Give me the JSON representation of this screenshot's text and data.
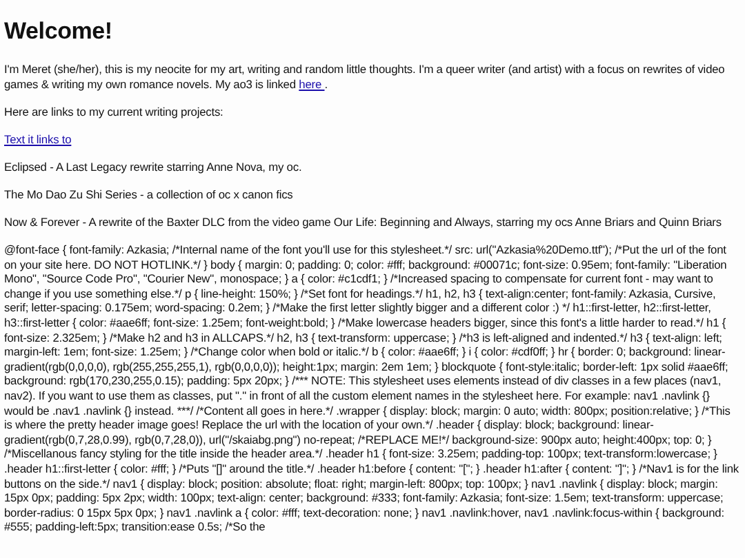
{
  "heading": "Welcome!",
  "intro": {
    "text": "I'm Meret (she/her), this is my neocite for my art, writing and random little thoughts. I'm a queer writer (and artist) with a focus on rewrites of video games & writing my own romance novels. My ao3 is linked ",
    "link": "here ",
    "after": "."
  },
  "projects_intro": "Here are links to my current writing projects:",
  "link": "Text it links to",
  "projects": [
    "Eclipsed - A Last Legacy rewrite starring Anne Nova, my oc.",
    "The Mo Dao Zu Shi Series - a collection of oc x canon fics",
    "Now & Forever - A rewrite of the Baxter DLC from the video game Our Life: Beginning and Always, starring my ocs Anne Briars and Quinn Briars"
  ],
  "stylesheet_text": "@font-face { font-family: Azkasia; /*Internal name of the font you'll use for this stylesheet.*/ src: url(\"Azkasia%20Demo.ttf\"); /*Put the url of the font on your site here. DO NOT HOTLINK.*/ } body { margin: 0; padding: 0; color: #fff; background: #00071c; font-size: 0.95em; font-family: \"Liberation Mono\", \"Source Code Pro\", \"Courier New\", monospace; } a { color: #c1cdf1; } /*Increased spacing to compensate for current font - may want to change if you use something else.*/ p { line-height: 150%; } /*Set font for headings.*/ h1, h2, h3 { text-align:center; font-family: Azkasia, Cursive, serif; letter-spacing: 0.175em; word-spacing: 0.2em; } /*Make the first letter slightly bigger and a different color :) */ h1::first-letter, h2::first-letter, h3::first-letter { color: #aae6ff; font-size: 1.25em; font-weight:bold; } /*Make lowercase headers bigger, since this font's a little harder to read.*/ h1 { font-size: 2.325em; } /*Make h2 and h3 in ALLCAPS.*/ h2, h3 { text-transform: uppercase; } /*h3 is left-aligned and indented.*/ h3 { text-align: left; margin-left: 1em; font-size: 1.25em; } /*Change color when bold or italic.*/ b { color: #aae6ff; } i { color: #cdf0ff; } hr { border: 0; background: linear-gradient(rgb(0,0,0,0), rgb(255,255,255,1), rgb(0,0,0,0)); height:1px; margin: 2em 1em; } blockquote { font-style:italic; border-left: 1px solid #aae6ff; background: rgb(170,230,255,0.15); padding: 5px 20px; } /*** NOTE: This stylesheet uses elements instead of div classes in a few places (nav1, nav2). If you want to use them as classes, put \".\" in front of all the custom element names in the stylesheet here. For example: nav1 .navlink {} would be .nav1 .navlink {} instead. ***/ /*Content all goes in here.*/ .wrapper { display: block; margin: 0 auto; width: 800px; position:relative; } /*This is where the pretty header image goes! Replace the url with the location of your own.*/ .header { display: block; background: linear-gradient(rgb(0,7,28,0.99), rgb(0,7,28,0)), url(\"/skaiabg.png\") no-repeat; /*REPLACE ME!*/ background-size: 900px auto; height:400px; top: 0; } /*Miscellanous fancy styling for the title inside the header area.*/ .header h1 { font-size: 3.25em; padding-top: 100px; text-transform:lowercase; } .header h1::first-letter { color: #fff; } /*Puts \"[]\" around the title.*/ .header h1:before { content: \"[\"; } .header h1:after { content: \"]\"; } /*Nav1 is for the link buttons on the side.*/ nav1 { display: block; position: absolute; float: right; margin-left: 800px; top: 100px; } nav1 .navlink { display: block; margin: 15px 0px; padding: 5px 2px; width: 100px; text-align: center; background: #333; font-family: Azkasia; font-size: 1.5em; text-transform: uppercase; border-radius: 0 15px 5px 0px; } nav1 .navlink a { color: #fff; text-decoration: none; } nav1 .navlink:hover, nav1 .navlink:focus-within { background: #555; padding-left:5px; transition:ease 0.5s; /*So the"
}
